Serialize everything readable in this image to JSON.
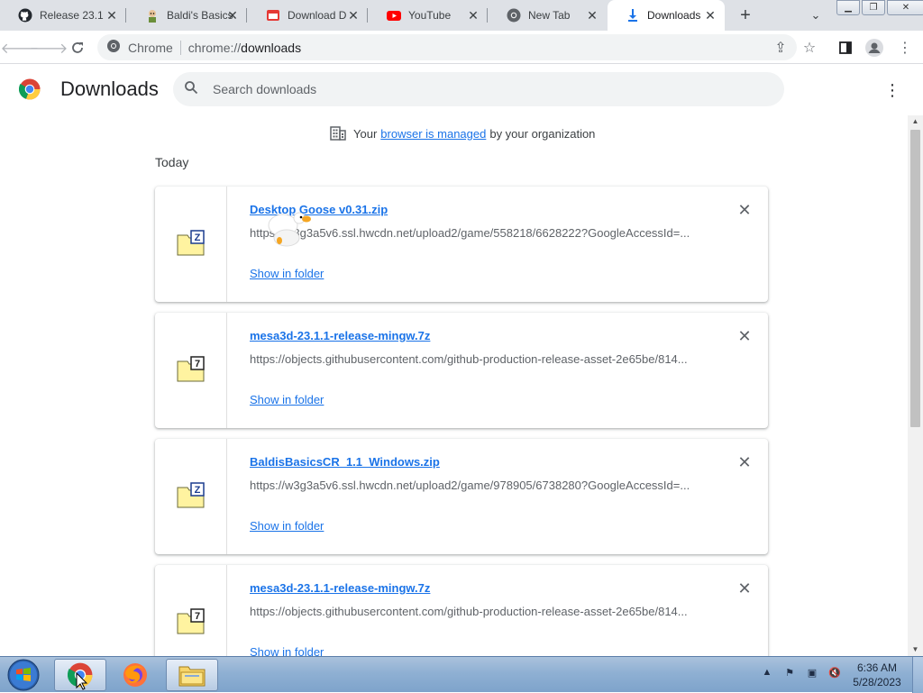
{
  "tabs": [
    {
      "title": "Release 23.1",
      "icon": "github-icon"
    },
    {
      "title": "Baldi's Basics",
      "icon": "baldi-icon"
    },
    {
      "title": "Download D",
      "icon": "pdf-icon"
    },
    {
      "title": "YouTube",
      "icon": "youtube-icon"
    },
    {
      "title": "New Tab",
      "icon": "chrome-icon"
    },
    {
      "title": "Downloads",
      "icon": "download-icon"
    }
  ],
  "omnibox": {
    "chip": "Chrome",
    "url_scheme": "chrome://",
    "url_path": "downloads"
  },
  "header": {
    "title": "Downloads",
    "search_placeholder": "Search downloads"
  },
  "managed": {
    "prefix": "Your",
    "link": "browser is managed",
    "suffix": "by your organization"
  },
  "date_heading": "Today",
  "downloads": [
    {
      "name": "Desktop Goose v0.31.zip",
      "url": "https://w3g3a5v6.ssl.hwcdn.net/upload2/game/558218/6628222?GoogleAccessId=...",
      "action": "Show in folder",
      "type": "zip"
    },
    {
      "name": "mesa3d-23.1.1-release-mingw.7z",
      "url": "https://objects.githubusercontent.com/github-production-release-asset-2e65be/814...",
      "action": "Show in folder",
      "type": "7z"
    },
    {
      "name": "BaldisBasicsCR_1.1_Windows.zip",
      "url": "https://w3g3a5v6.ssl.hwcdn.net/upload2/game/978905/6738280?GoogleAccessId=...",
      "action": "Show in folder",
      "type": "zip"
    },
    {
      "name": "mesa3d-23.1.1-release-mingw.7z",
      "url": "https://objects.githubusercontent.com/github-production-release-asset-2e65be/814...",
      "action": "Show in folder",
      "type": "7z"
    }
  ],
  "taskbar": {
    "time": "6:36 AM",
    "date": "5/28/2023"
  },
  "colors": {
    "link": "#1a73e8",
    "tabstrip": "#dee1e6",
    "omnibox": "#f1f3f4"
  }
}
